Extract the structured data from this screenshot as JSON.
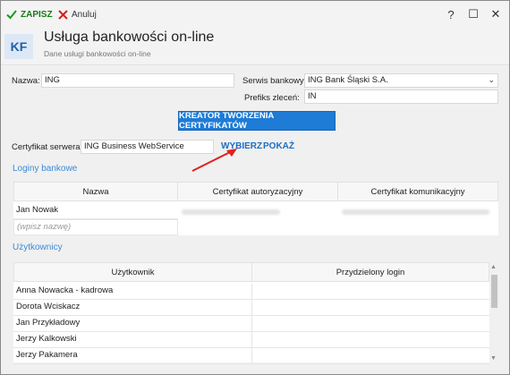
{
  "toolbar": {
    "save_label": "ZAPISZ",
    "cancel_label": "Anuluj",
    "help": "?",
    "maximize": "☐",
    "close": "✕"
  },
  "header": {
    "logo": "KF",
    "title": "Usługa bankowości on-line",
    "subtitle": "Dane usługi bankowości on-line"
  },
  "form": {
    "name_label": "Nazwa:",
    "name_value": "ING",
    "bank_service_label": "Serwis bankowy:",
    "bank_service_value": "ING Bank Śląski S.A.",
    "order_prefix_label": "Prefiks zleceń:",
    "order_prefix_value": "IN",
    "wizard_button": "KREATOR TWORZENIA CERTYFIKATÓW",
    "server_cert_label": "Certyfikat serwera:",
    "server_cert_value": "ING Business WebService",
    "choose_link": "WYBIERZ",
    "show_link": "POKAŻ"
  },
  "bank_logins": {
    "section_label": "Loginy bankowe",
    "columns": [
      "Nazwa",
      "Certyfikat autoryzacyjny",
      "Certyfikat komunikacyjny"
    ],
    "rows": [
      {
        "name": "Jan Nowak"
      }
    ],
    "new_placeholder": "(wpisz nazwę)"
  },
  "users": {
    "section_label": "Użytkownicy",
    "columns": [
      "Użytkownik",
      "Przydzielony login"
    ],
    "rows": [
      {
        "user": "Anna Nowacka - kadrowa",
        "login": ""
      },
      {
        "user": "Dorota Wciskacz",
        "login": ""
      },
      {
        "user": "Jan Przykładowy",
        "login": ""
      },
      {
        "user": "Jerzy Kalkowski",
        "login": ""
      },
      {
        "user": "Jerzy Pakamera",
        "login": ""
      }
    ]
  },
  "colors": {
    "accent": "#1e7bd6",
    "save_green": "#1a7a1a",
    "cancel_red": "#d21f1f",
    "annotation_red": "#e02020"
  }
}
